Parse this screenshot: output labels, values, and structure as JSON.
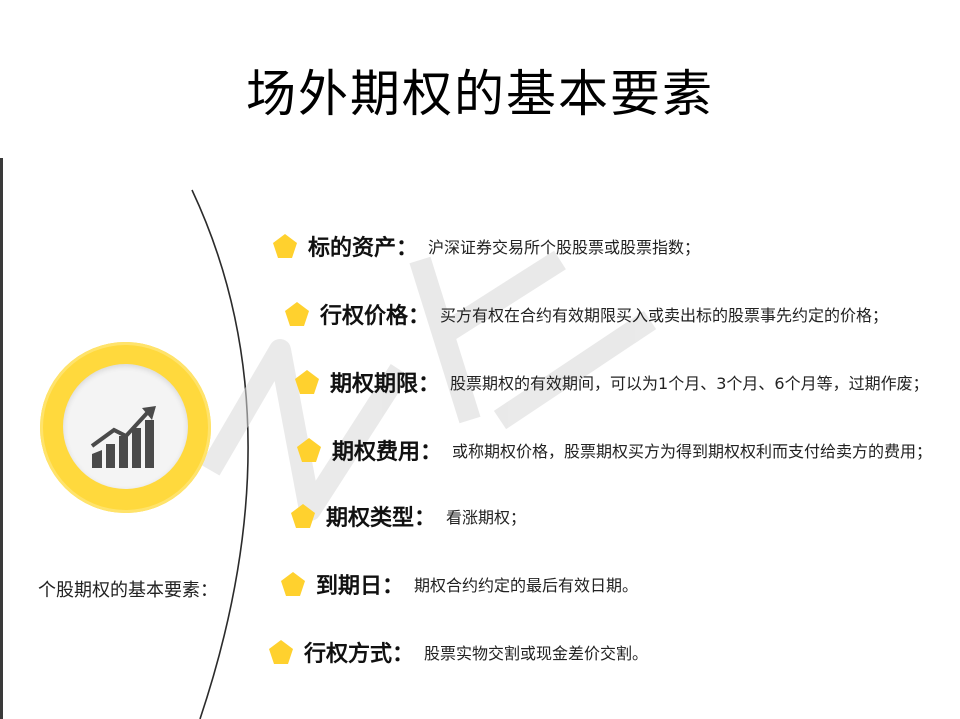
{
  "title": "场外期权的基本要素",
  "left_label": "个股期权的基本要素：",
  "colors": {
    "accent": "#ffd12e",
    "ring": "#ffd93d",
    "text": "#111111"
  },
  "items": [
    {
      "name": "标的资产",
      "colon": "：",
      "desc": "沪深证券交易所个股股票或股票指数；"
    },
    {
      "name": "行权价格",
      "colon": "：",
      "desc": "买方有权在合约有效期限买入或卖出标的股票事先约定的价格；"
    },
    {
      "name": "期权期限",
      "colon": "：",
      "desc": "股票期权的有效期间，可以为1个月、3个月、6个月等，过期作废；"
    },
    {
      "name": "期权费用",
      "colon": "：",
      "desc": "或称期权价格，股票期权买方为得到期权权利而支付给卖方的费用；"
    },
    {
      "name": "期权类型",
      "colon": "：",
      "desc": "看涨期权；"
    },
    {
      "name": "到期日",
      "colon": "：",
      "desc": "期权合约约定的最后有效日期。"
    },
    {
      "name": "行权方式",
      "colon": "：",
      "desc": "股票实物交割或现金差价交割。"
    }
  ],
  "icons": {
    "center": "bar-chart-trend-icon",
    "bullet": "pentagon-bullet-icon"
  }
}
